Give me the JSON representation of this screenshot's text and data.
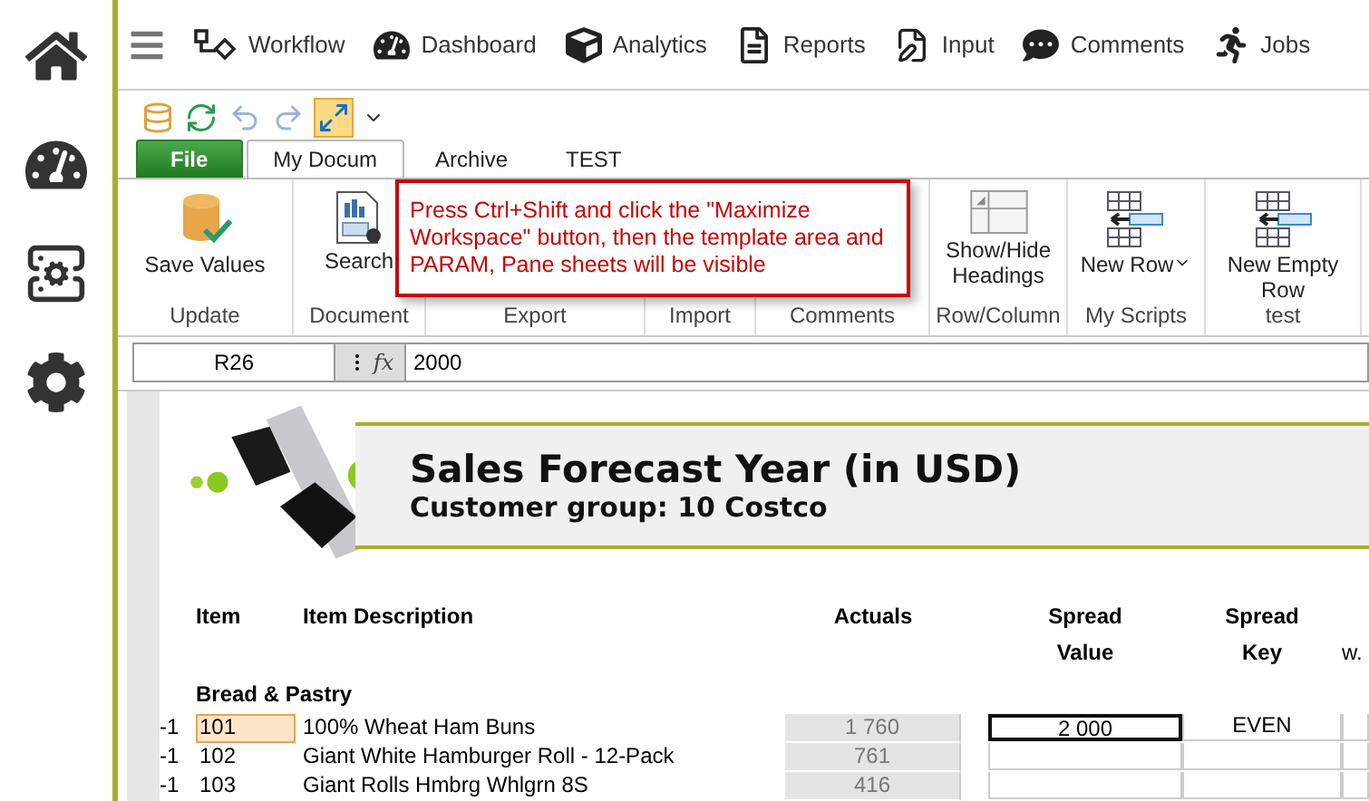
{
  "nav": {
    "items": [
      {
        "label": "Workflow"
      },
      {
        "label": "Dashboard"
      },
      {
        "label": "Analytics"
      },
      {
        "label": "Reports"
      },
      {
        "label": "Input"
      },
      {
        "label": "Comments"
      },
      {
        "label": "Jobs"
      }
    ]
  },
  "ribbon": {
    "file_button": "File",
    "tabs": [
      {
        "label": "My Docum",
        "selected": true
      },
      {
        "label": "Archive",
        "selected": false
      },
      {
        "label": "TEST",
        "selected": false
      }
    ],
    "groups": [
      {
        "label": "Update",
        "buttons": [
          {
            "label": "Save Values"
          }
        ]
      },
      {
        "label": "Document",
        "buttons": [
          {
            "label": "Search"
          }
        ]
      },
      {
        "label": "Export"
      },
      {
        "label": "Import"
      },
      {
        "label": "Comments"
      },
      {
        "label": "Row/Column",
        "buttons": [
          {
            "label": "Show/Hide Headings"
          }
        ]
      },
      {
        "label": "My Scripts",
        "buttons": [
          {
            "label": "New Row",
            "dropdown": true
          }
        ]
      },
      {
        "label": "test",
        "buttons": [
          {
            "label": "New Empty Row"
          }
        ]
      }
    ]
  },
  "tooltip": {
    "text": "Press Ctrl+Shift and click the \"Maximize Workspace\" button, then the template area and PARAM, Pane sheets will be visible"
  },
  "formula_bar": {
    "cell": "R26",
    "function_symbol": "fx",
    "value": "2000"
  },
  "sheet": {
    "title": "Sales Forecast Year (in USD)",
    "subtitle": "Customer group: 10 Costco",
    "columns": [
      {
        "label": "Item"
      },
      {
        "label": "Item Description"
      },
      {
        "label": "Actuals"
      },
      {
        "label": "Spread",
        "label_2": "Value"
      },
      {
        "label": "Spread",
        "label_2": "Key"
      },
      {
        "label_2": "w."
      }
    ],
    "section": "Bread & Pastry",
    "rows": [
      {
        "flag": "-1",
        "item": "101",
        "description": "100% Wheat Ham Buns",
        "actuals": "1 760",
        "spread_value": "2 000",
        "spread_key": "EVEN",
        "selected": true
      },
      {
        "flag": "-1",
        "item": "102",
        "description": "Giant White Hamburger Roll - 12-Pack",
        "actuals": "761",
        "selected": false
      },
      {
        "flag": "-1",
        "item": "103",
        "description": "Giant Rolls Hmbrg Whlgrn 8S",
        "actuals": "416",
        "selected": false
      }
    ]
  }
}
